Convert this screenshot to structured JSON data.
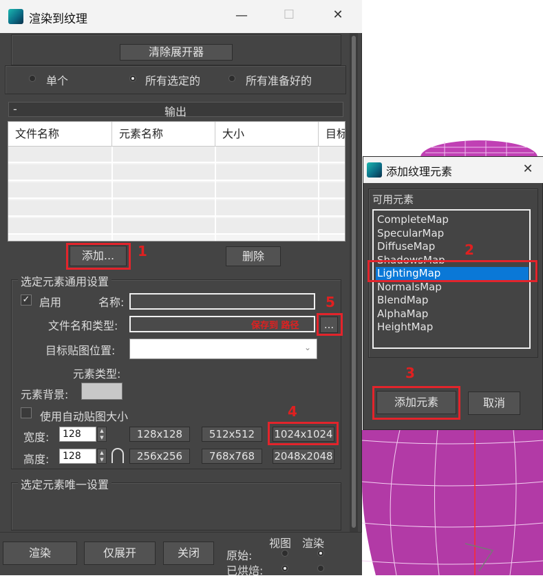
{
  "main_window": {
    "title": "渲染到纹理",
    "minimize": "—",
    "maximize": "☐",
    "close": "✕"
  },
  "top_section": {
    "clear_unwrapper_button": "清除展开器",
    "radio_single": "单个",
    "radio_all_selected": "所有选定的",
    "radio_all_prepared": "所有准备好的",
    "selected": "所有选定的"
  },
  "output": {
    "collapse": "-",
    "title": "输出",
    "columns": [
      "文件名称",
      "元素名称",
      "大小",
      "目标"
    ],
    "add_button": "添加...",
    "delete_button": "删除"
  },
  "common_settings": {
    "title": "选定元素通用设置",
    "enable_checkbox": "启用",
    "enable_checked": true,
    "name_label": "名称:",
    "name_value": "",
    "file_name_type_label": "文件名和类型:",
    "save_to_path_note": "保存到 路径",
    "browse_button": "...",
    "target_map_label": "目标贴图位置:",
    "target_map_value": "",
    "element_type_label": "元素类型:",
    "element_bg_label": "元素背景:",
    "element_bg_color": "#c8c8c8",
    "auto_map_size": "使用自动贴图大小",
    "width_label": "宽度:",
    "width_value": "128",
    "height_label": "高度:",
    "height_value": "128",
    "size_presets": [
      "128x128",
      "512x512",
      "1024x1024",
      "256x256",
      "768x768",
      "2048x2048"
    ]
  },
  "unique_settings": {
    "title": "选定元素唯一设置"
  },
  "bottom_bar": {
    "render_button": "渲染",
    "unwrap_only_button": "仅展开",
    "close_button": "关闭",
    "view_label": "视图",
    "render_label": "渲染",
    "original_label": "原始:",
    "baked_label": "已烘焙:"
  },
  "annotations": [
    "1",
    "2",
    "3",
    "4",
    "5"
  ],
  "dialog": {
    "title": "添加纹理元素",
    "close": "✕",
    "available_label": "可用元素",
    "elements": [
      "CompleteMap",
      "SpecularMap",
      "DiffuseMap",
      "ShadowsMap",
      "LightingMap",
      "NormalsMap",
      "BlendMap",
      "AlphaMap",
      "HeightMap"
    ],
    "selected_element": "LightingMap",
    "add_button": "添加元素",
    "cancel_button": "取消"
  },
  "colors": {
    "panel_bg": "#444444",
    "selection": "#0a78d7",
    "annotation_red": "#e3242b",
    "viewport_object": "#b03aa4"
  }
}
